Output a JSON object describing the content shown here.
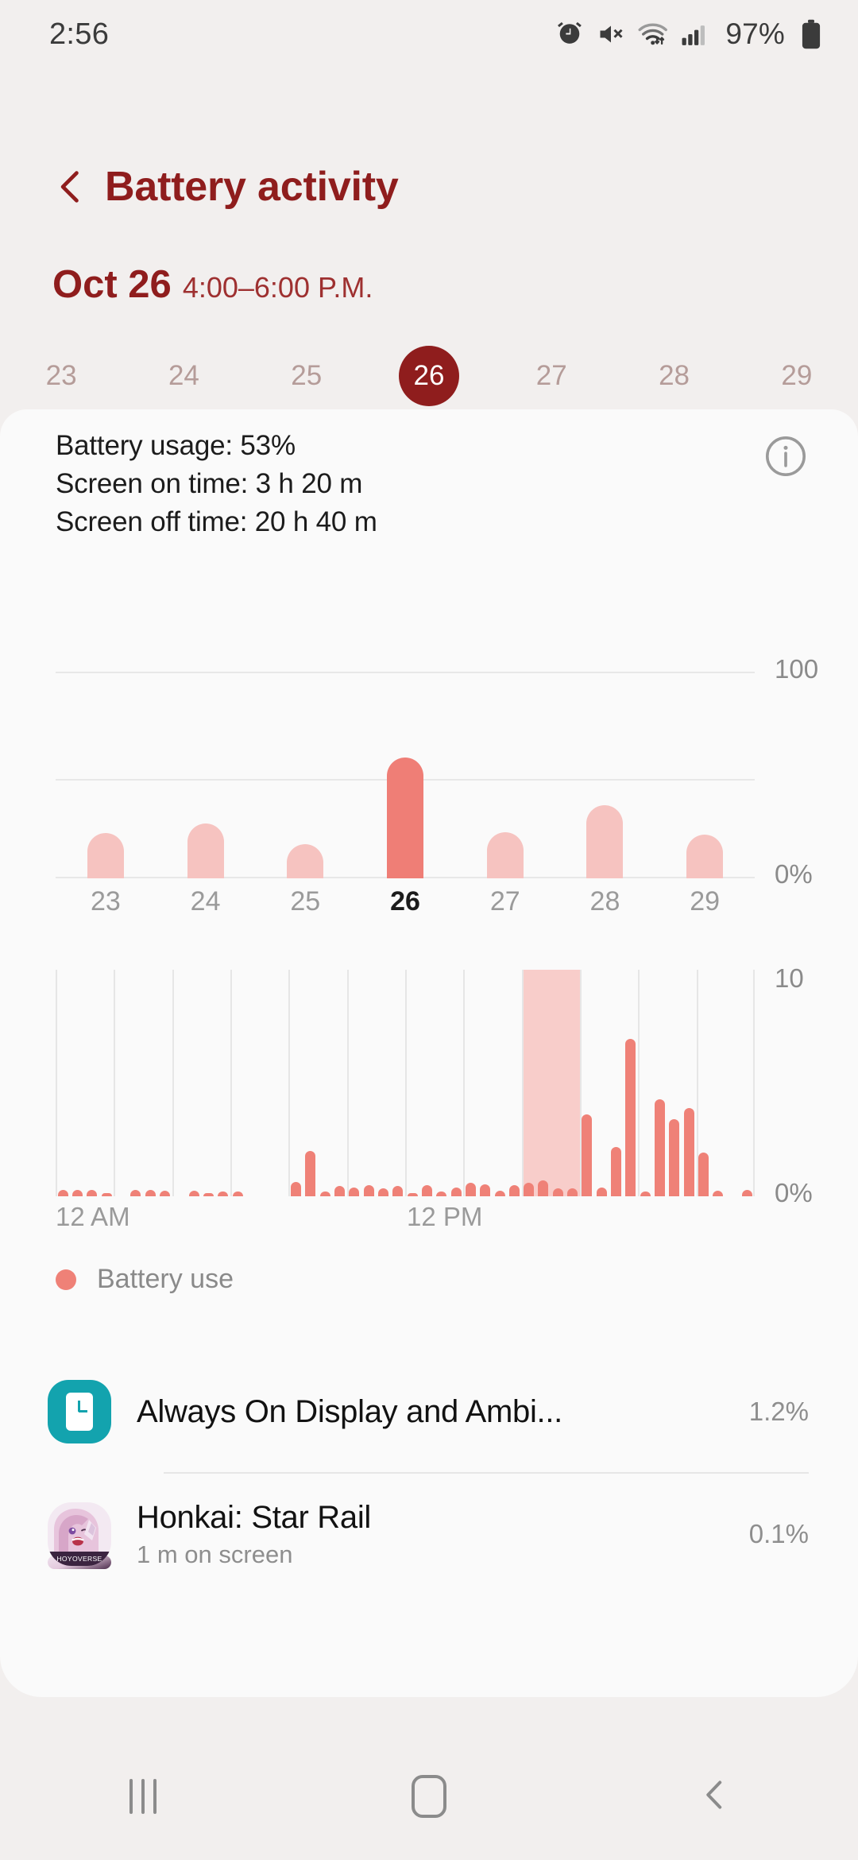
{
  "status_bar": {
    "time": "2:56",
    "battery_percent": "97%",
    "icons": [
      "alarm-icon",
      "mute-icon",
      "wifi-icon",
      "signal-icon",
      "battery-icon"
    ]
  },
  "header": {
    "back_label": "Back",
    "title": "Battery activity"
  },
  "date_line": {
    "date": "Oct 26",
    "range": "4:00–6:00 P.M."
  },
  "day_selector": {
    "days": [
      "23",
      "24",
      "25",
      "26",
      "27",
      "28",
      "29"
    ],
    "selected": "26"
  },
  "summary": {
    "battery_usage": "Battery usage: 53%",
    "screen_on": "Screen on time: 3 h 20 m",
    "screen_off": "Screen off time: 20 h 40 m",
    "info_icon": "info-icon"
  },
  "legend": {
    "dot_color": "#ef8177",
    "label": "Battery use"
  },
  "app_list": [
    {
      "icon": "always-on-display-icon",
      "name": "Always On Display and Ambi...",
      "subtitle": "",
      "percent": "1.2%"
    },
    {
      "icon": "honkai-star-rail-icon",
      "name": "Honkai: Star Rail",
      "subtitle": "1 m on screen",
      "percent": "0.1%"
    }
  ],
  "nav_bar": {
    "recents_label": "Recents",
    "home_label": "Home",
    "back_label": "Back"
  },
  "colors": {
    "accent_dark_red": "#8f1d1d",
    "bar_light": "#f6c3c0",
    "bar_highlight": "#ef7e76",
    "background": "#f2efee",
    "card": "#fafafa",
    "aod_icon": "#13a3ae"
  },
  "chart_data": [
    {
      "type": "bar",
      "name": "daily-battery-usage",
      "title": "",
      "xlabel": "",
      "ylabel": "",
      "categories": [
        "23",
        "24",
        "25",
        "26",
        "27",
        "28",
        "29"
      ],
      "values": [
        20,
        24,
        15,
        53,
        20,
        32,
        19
      ],
      "highlight_index": 3,
      "ylim": [
        0,
        100
      ],
      "ytick_labels": [
        "0%",
        "100"
      ],
      "gridlines": [
        0,
        50,
        100
      ],
      "grid": true,
      "legend": "none"
    },
    {
      "type": "bar",
      "name": "hourly-battery-usage",
      "title": "",
      "xlabel": "",
      "ylabel": "",
      "x": [
        "12 AM",
        "12:30 AM",
        "1 AM",
        "1:30 AM",
        "2 AM",
        "2:30 AM",
        "3 AM",
        "3:30 AM",
        "4 AM",
        "4:30 AM",
        "5 AM",
        "5:30 AM",
        "6 AM",
        "6:30 AM",
        "7 AM",
        "7:30 AM",
        "8 AM",
        "8:30 AM",
        "9 AM",
        "9:30 AM",
        "10 AM",
        "10:30 AM",
        "11 AM",
        "11:30 AM",
        "12 PM",
        "12:30 PM",
        "1 PM",
        "1:30 PM",
        "2 PM",
        "2:30 PM",
        "3 PM",
        "3:30 PM",
        "4 PM",
        "4:30 PM",
        "5 PM",
        "5:30 PM",
        "6 PM",
        "6:30 PM",
        "7 PM",
        "7:30 PM",
        "8 PM",
        "8:30 PM",
        "9 PM",
        "9:30 PM",
        "10 PM",
        "10:30 PM",
        "11 PM",
        "11:30 PM"
      ],
      "values": [
        0.25,
        0.25,
        0.25,
        0.1,
        0.0,
        0.25,
        0.25,
        0.2,
        0.0,
        0.2,
        0.1,
        0.15,
        0.15,
        0.0,
        0.0,
        0.0,
        0.6,
        2.0,
        0.15,
        0.4,
        0.35,
        0.45,
        0.3,
        0.4,
        0.1,
        0.45,
        0.15,
        0.35,
        0.55,
        0.5,
        0.2,
        0.45,
        0.55,
        0.65,
        0.3,
        0.3,
        3.6,
        0.35,
        2.1,
        7.0,
        0.15,
        4.3,
        3.4,
        3.9,
        1.9,
        0.2,
        0.0,
        0.25
      ],
      "ylim": [
        0,
        10
      ],
      "ytick_labels": [
        "0%",
        "10"
      ],
      "xtick_labels": [
        "12 AM",
        "12 PM"
      ],
      "highlight_band": {
        "start": "4 PM",
        "end": "6 PM",
        "color": "#f8cdca"
      },
      "grid": true,
      "legend": "Battery use"
    }
  ]
}
